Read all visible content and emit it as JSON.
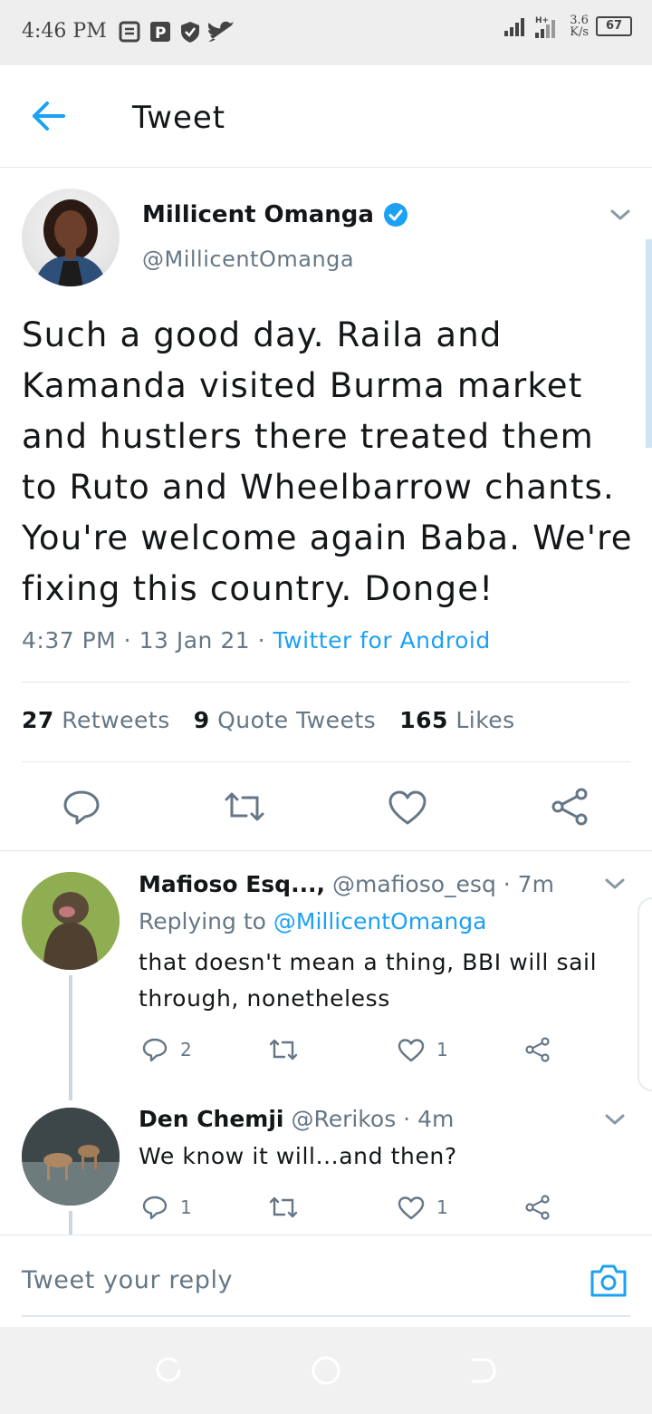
{
  "status_bar": {
    "time": "4:46 PM",
    "notification_icons": [
      "clipboard-icon",
      "parking-icon",
      "shield-icon",
      "twitter-icon"
    ],
    "network_speed_value": "3.6",
    "network_speed_unit": "K/s",
    "battery": "67"
  },
  "header": {
    "back_icon": "arrow-left-icon",
    "title": "Tweet"
  },
  "tweet": {
    "author_name": "Millicent Omanga",
    "verified_icon": "verified-badge-icon",
    "author_handle": "@MillicentOmanga",
    "text": "Such a good day. Raila and Kamanda visited Burma market and hustlers there treated them to Ruto and Wheelbarrow chants. You're welcome again Baba. We're fixing this country. Donge!",
    "time": "4:37 PM",
    "sep1": " · ",
    "date": "13 Jan 21",
    "sep2": " · ",
    "source": "Twitter for Android",
    "retweets_count": "27",
    "retweets_label": "Retweets",
    "quotes_count": "9",
    "quotes_label": "Quote Tweets",
    "likes_count": "165",
    "likes_label": "Likes",
    "actions": [
      "reply-icon",
      "retweet-icon",
      "like-icon",
      "share-icon"
    ]
  },
  "replies": [
    {
      "name": "Mafioso Esq...,",
      "handle": "@mafioso_esq",
      "sep": " · ",
      "age": "7m",
      "replying_prefix": "Replying to ",
      "replying_to": "@MillicentOmanga",
      "text": "that doesn't mean a thing, BBI will sail through, nonetheless",
      "reply_count": "2",
      "retweet_count": "",
      "like_count": "1"
    },
    {
      "name": "Den Chemji",
      "handle": "@Rerikos",
      "sep": " · ",
      "age": "4m",
      "text": "We know it will...and then?",
      "reply_count": "1",
      "retweet_count": "",
      "like_count": "1"
    }
  ],
  "compose": {
    "placeholder": "Tweet your reply",
    "camera_icon": "camera-icon"
  },
  "nav": [
    "recents-icon",
    "home-icon",
    "back-icon"
  ],
  "colors": {
    "accent": "#1da1f2",
    "text": "#14171a",
    "secondary": "#657786",
    "divider": "#e1e8ed"
  }
}
